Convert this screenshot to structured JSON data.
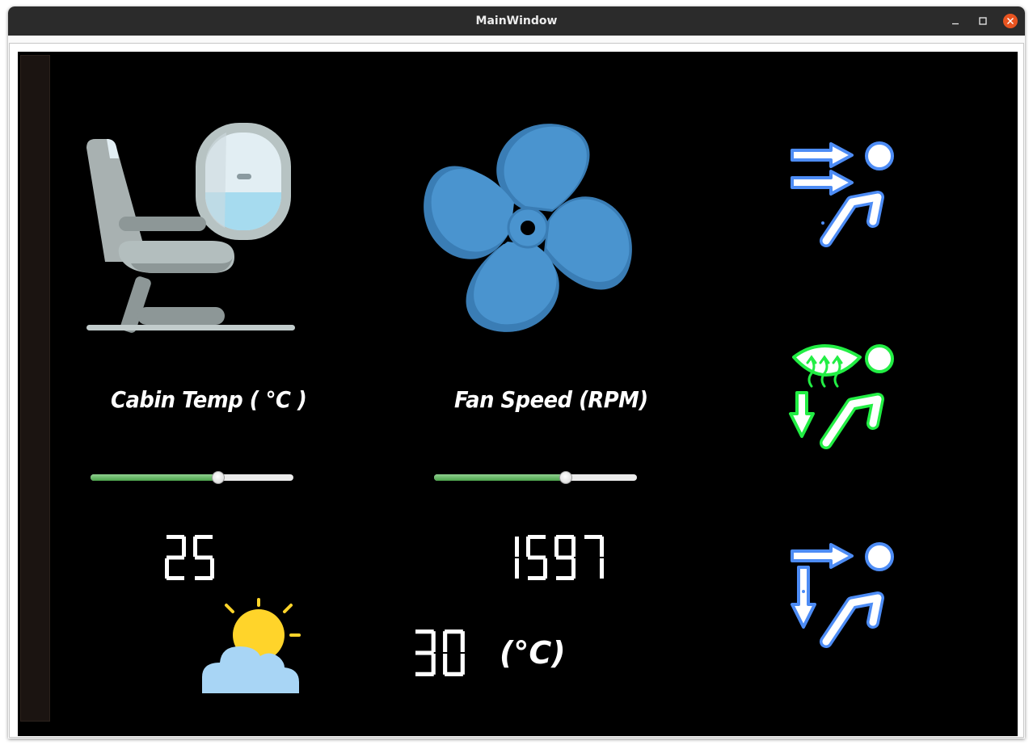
{
  "window": {
    "title": "MainWindow"
  },
  "titlebar_buttons": {
    "minimize": "minimize-icon",
    "maximize": "maximize-icon",
    "close": "close-icon"
  },
  "cabin": {
    "label": "Cabin Temp ( °C )",
    "slider_fraction": 0.63,
    "value": "25",
    "icon": "airplane-seat-window-icon"
  },
  "fan": {
    "label": "Fan Speed (RPM)",
    "slider_fraction": 0.65,
    "value": "1597",
    "icon": "fan-icon"
  },
  "outside": {
    "value": "30",
    "unit": "(°C)",
    "icon": "partly-cloudy-icon"
  },
  "airflow_modes": [
    {
      "name": "face-airflow-mode",
      "color": "#4d8cf5"
    },
    {
      "name": "defrost-floor-airflow-mode",
      "color": "#22ee44"
    },
    {
      "name": "face-floor-airflow-mode",
      "color": "#4d8cf5"
    }
  ],
  "colors": {
    "background": "#000000",
    "slider_fill": "#5cb85c",
    "fan_blue": "#4a94cf",
    "airflow_blue": "#4d8cf5",
    "airflow_green": "#22ee44",
    "sun_yellow": "#ffd42a",
    "cloud_blue": "#a8d5f5"
  }
}
